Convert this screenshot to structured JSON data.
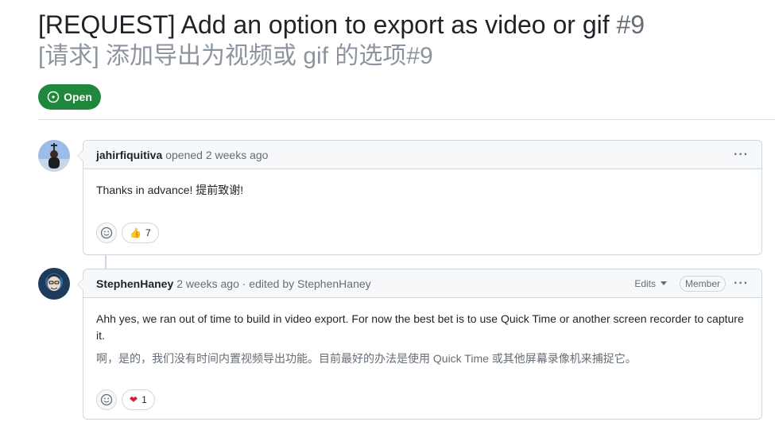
{
  "issue": {
    "title": "[REQUEST] Add an option to export as video or gif",
    "number": "#9",
    "title_translated": "[请求] 添加导出为视频或 gif 的选项",
    "number_translated": "#9",
    "state": "Open",
    "state_icon": "issue-opened-icon",
    "state_color": "#1f883d"
  },
  "comments": [
    {
      "author": "jahirfiquitiva",
      "action": "opened 2 weeks ago",
      "menu": "···",
      "body": [
        "Thanks in advance!  提前致谢!"
      ],
      "reactions": [
        {
          "icon": "thumbs-up-icon",
          "emoji": "👍",
          "count": "7"
        }
      ]
    },
    {
      "author": "StephenHaney",
      "action": "2 weeks ago · edited by StephenHaney",
      "edits_label": "Edits",
      "role_badge": "Member",
      "menu": "···",
      "body": [
        "Ahh yes, we ran out of time to build in video export. For now the best bet is to use Quick Time or another screen recorder to capture it.",
        "啊，是的，我们没有时间内置视频导出功能。目前最好的办法是使用 Quick Time 或其他屏幕录像机来捕捉它。"
      ],
      "reactions": [
        {
          "icon": "heart-icon",
          "emoji": "❤",
          "count": "1",
          "color": "#cf222e"
        }
      ]
    }
  ]
}
